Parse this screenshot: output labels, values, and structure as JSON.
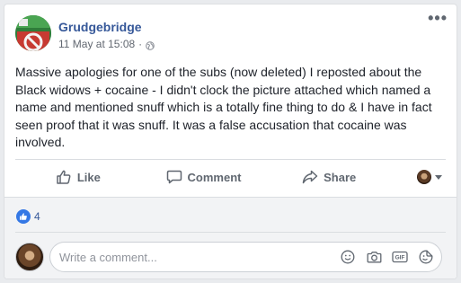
{
  "post": {
    "page_name": "Grudgebridge",
    "timestamp": "11 May at 15:08",
    "separator": "·",
    "more_label": "•••",
    "text": "Massive apologies for one of the subs (now deleted) I reposted about the Black widows + cocaine - I didn't clock the picture attached which named a name and mentioned snuff which is a totally fine thing to do & I have in fact seen proof that it was snuff. It was a false accusation that cocaine was involved."
  },
  "actions": {
    "like_label": "Like",
    "comment_label": "Comment",
    "share_label": "Share"
  },
  "reactions": {
    "like_count": "4"
  },
  "comment": {
    "placeholder": "Write a comment..."
  },
  "icons": {
    "privacy": "globe-icon",
    "like": "thumbs-up-icon",
    "comment": "speech-bubble-icon",
    "share": "share-arrow-icon",
    "emoji": "smiley-icon",
    "camera": "camera-icon",
    "gif": "gif-icon",
    "sticker": "sticker-icon"
  },
  "colors": {
    "brand_link": "#365899",
    "like_blue": "#3578e5",
    "muted_text": "#606770",
    "page_bg": "#e9ebee"
  }
}
